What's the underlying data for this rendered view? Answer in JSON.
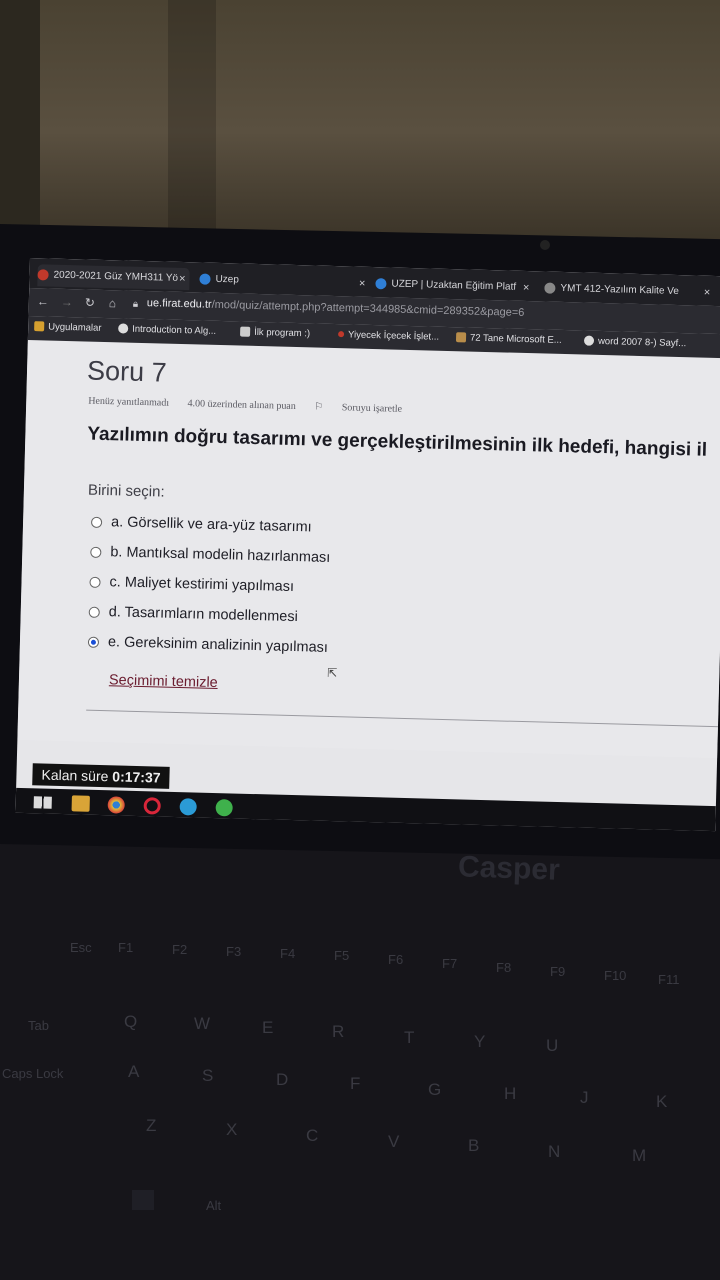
{
  "tabs": [
    {
      "label": "2020-2021 Güz YMH311 Yö",
      "close": "×",
      "icon": "site-icon"
    },
    {
      "label": "Uzep",
      "close": "×",
      "icon": "ie-icon"
    },
    {
      "label": "UZEP | Uzaktan Eğitim Platf",
      "close": "×",
      "icon": "ie-icon"
    },
    {
      "label": "YMT 412-Yazılım Kalite Ve",
      "close": "×",
      "icon": "globe-icon"
    }
  ],
  "address": {
    "host": "ue.firat.edu.tr",
    "path": "/mod/quiz/attempt.php?attempt=344985&cmid=289352&page=6"
  },
  "bookmarks": [
    {
      "label": "Uygulamalar"
    },
    {
      "label": "Introduction to Alg..."
    },
    {
      "label": "İlk program :)"
    },
    {
      "label": "Yiyecek İçecek İşlet..."
    },
    {
      "label": "72 Tane Microsoft E..."
    },
    {
      "label": "word 2007 8-) Sayf..."
    }
  ],
  "question": {
    "title": "Soru 7",
    "status": "Henüz yanıtlanmadı",
    "points": "4.00 üzerinden alınan puan",
    "flag": "Soruyu işaretle",
    "text": "Yazılımın doğru tasarımı ve gerçekleştirilmesinin ilk hedefi, hangisi il",
    "prompt": "Birini seçin:",
    "options": [
      {
        "label": "a. Görsellik ve ara-yüz tasarımı",
        "selected": false
      },
      {
        "label": "b. Mantıksal modelin hazırlanması",
        "selected": false
      },
      {
        "label": "c. Maliyet kestirimi yapılması",
        "selected": false
      },
      {
        "label": "d. Tasarımların modellenmesi",
        "selected": false
      },
      {
        "label": "e. Gereksinim analizinin yapılması",
        "selected": true
      }
    ],
    "clear": "Seçimimi temizle"
  },
  "timer": {
    "label": "Kalan süre",
    "value": "0:17:37"
  },
  "laptop": {
    "brand": "Casper"
  },
  "keyboard": {
    "keys": [
      "Esc",
      "F1",
      "F2",
      "F3",
      "F4",
      "F5",
      "F6",
      "F7",
      "F8",
      "F9",
      "F10",
      "F11",
      "Tab",
      "Q",
      "W",
      "E",
      "R",
      "T",
      "Y",
      "U",
      "Caps Lock",
      "A",
      "S",
      "D",
      "F",
      "G",
      "H",
      "J",
      "K",
      "Z",
      "X",
      "C",
      "V",
      "B",
      "N",
      "M",
      "Alt"
    ]
  },
  "colors": {
    "accent": "#1a4fd6",
    "link": "#6a1b2e"
  }
}
